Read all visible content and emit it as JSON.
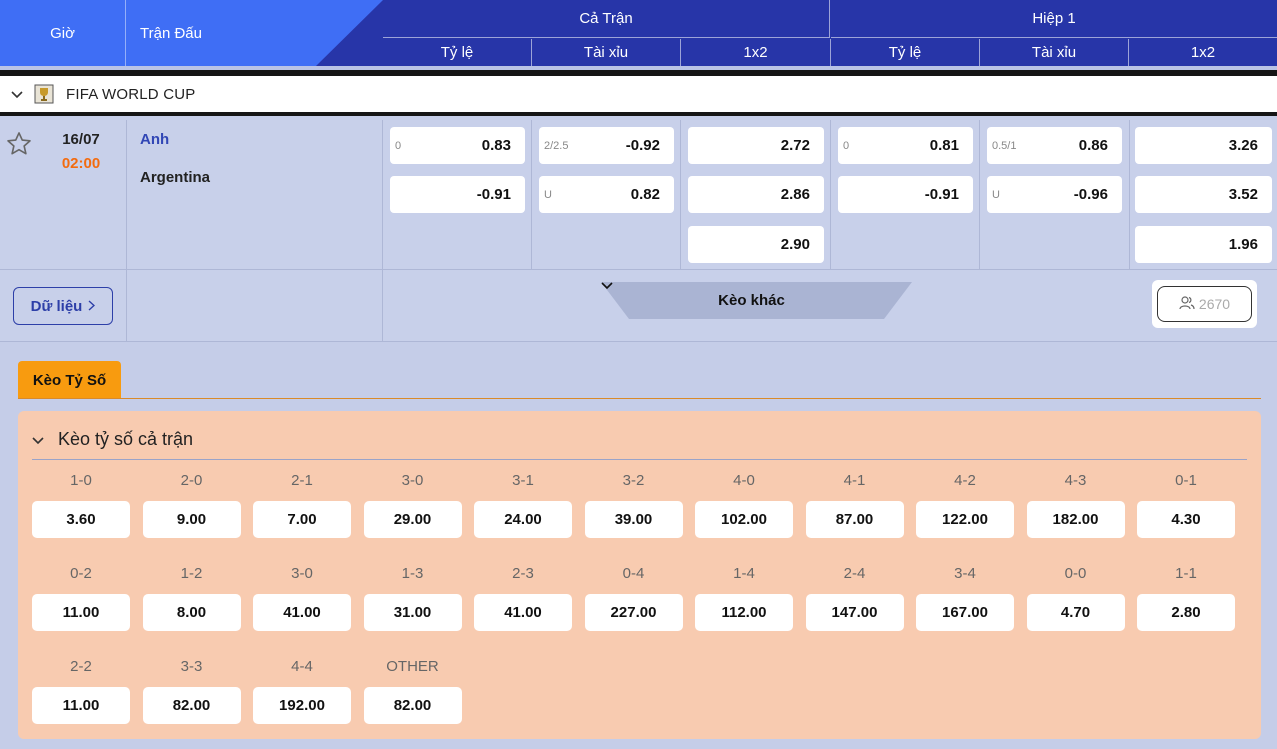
{
  "header": {
    "col_time": "Giờ",
    "col_match": "Trận Đấu",
    "group_full": "Cả Trận",
    "group_half": "Hiệp 1",
    "sub_cols": [
      "Tỷ lệ",
      "Tài xỉu",
      "1x2",
      "Tỷ lệ",
      "Tài xỉu",
      "1x2"
    ],
    "colors": {
      "header_blue": "#3f6ef5",
      "header_navy": "#2735a8",
      "accent_orange": "#f89b0f",
      "time_orange": "#f36b0f"
    }
  },
  "league": {
    "name": "FIFA WORLD CUP",
    "icon": "trophy-icon",
    "toggle_icon": "chevron-down-icon"
  },
  "match": {
    "date": "16/07",
    "time": "02:00",
    "home": "Anh",
    "away": "Argentina",
    "full": {
      "handicap": [
        {
          "h": "0",
          "v": "0.83"
        },
        {
          "h": "",
          "v": "-0.91"
        }
      ],
      "over_under": [
        {
          "h": "2/2.5",
          "v": "-0.92"
        },
        {
          "h": "U",
          "v": "0.82"
        }
      ],
      "x12": [
        "2.72",
        "2.86",
        "2.90"
      ]
    },
    "half": {
      "handicap": [
        {
          "h": "0",
          "v": "0.81"
        },
        {
          "h": "",
          "v": "-0.91"
        }
      ],
      "over_under": [
        {
          "h": "0.5/1",
          "v": "0.86"
        },
        {
          "h": "U",
          "v": "-0.96"
        }
      ],
      "x12": [
        "3.26",
        "3.52",
        "1.96"
      ]
    },
    "data_button": "Dữ liệu",
    "more_button": "Kèo khác",
    "viewers": "2670"
  },
  "score_tab": {
    "label": "Kèo Tỷ Số"
  },
  "score_panel": {
    "title": "Kèo tỷ số cả trận",
    "rows": [
      [
        {
          "s": "1-0",
          "o": "3.60"
        },
        {
          "s": "2-0",
          "o": "9.00"
        },
        {
          "s": "2-1",
          "o": "7.00"
        },
        {
          "s": "3-0",
          "o": "29.00"
        },
        {
          "s": "3-1",
          "o": "24.00"
        },
        {
          "s": "3-2",
          "o": "39.00"
        },
        {
          "s": "4-0",
          "o": "102.00"
        },
        {
          "s": "4-1",
          "o": "87.00"
        },
        {
          "s": "4-2",
          "o": "122.00"
        },
        {
          "s": "4-3",
          "o": "182.00"
        },
        {
          "s": "0-1",
          "o": "4.30"
        }
      ],
      [
        {
          "s": "0-2",
          "o": "11.00"
        },
        {
          "s": "1-2",
          "o": "8.00"
        },
        {
          "s": "3-0",
          "o": "41.00"
        },
        {
          "s": "1-3",
          "o": "31.00"
        },
        {
          "s": "2-3",
          "o": "41.00"
        },
        {
          "s": "0-4",
          "o": "227.00"
        },
        {
          "s": "1-4",
          "o": "112.00"
        },
        {
          "s": "2-4",
          "o": "147.00"
        },
        {
          "s": "3-4",
          "o": "167.00"
        },
        {
          "s": "0-0",
          "o": "4.70"
        },
        {
          "s": "1-1",
          "o": "2.80"
        }
      ],
      [
        {
          "s": "2-2",
          "o": "11.00"
        },
        {
          "s": "3-3",
          "o": "82.00"
        },
        {
          "s": "4-4",
          "o": "192.00"
        },
        {
          "s": "OTHER",
          "o": "82.00"
        }
      ]
    ]
  }
}
